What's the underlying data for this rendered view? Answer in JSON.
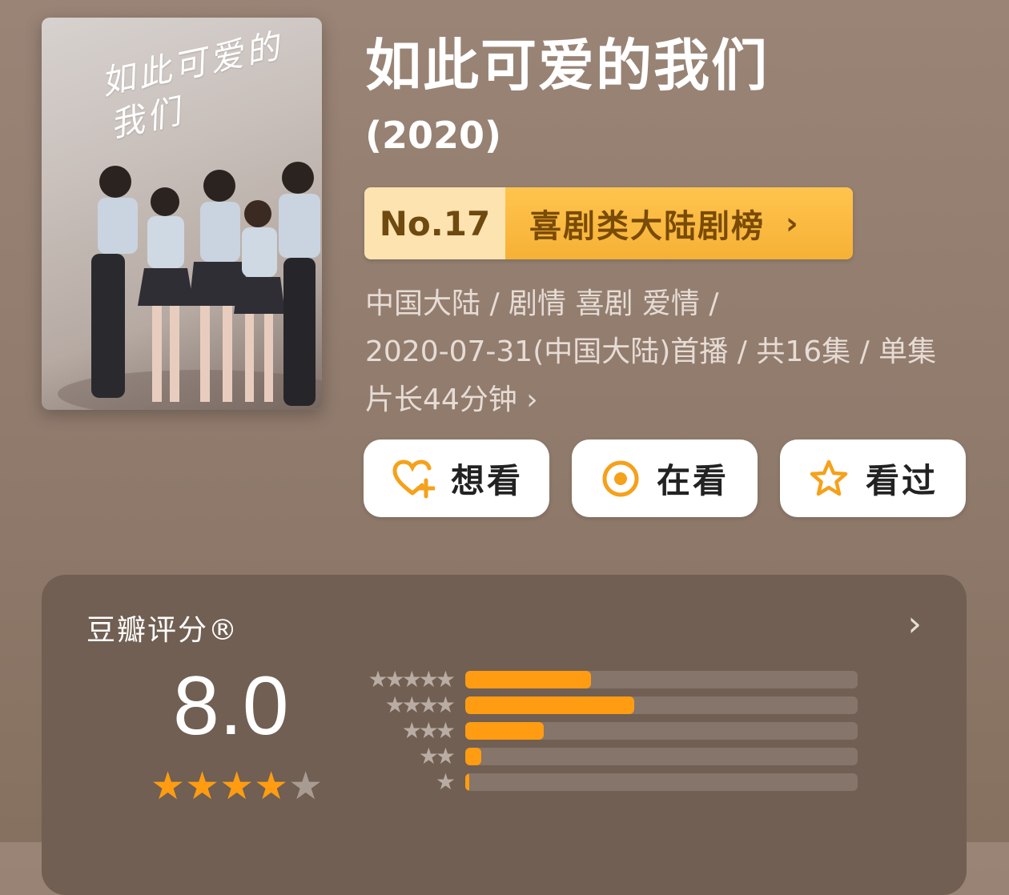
{
  "poster": {
    "title_art": "如此可爱的我们"
  },
  "header": {
    "title": "如此可爱的我们",
    "year": "(2020)"
  },
  "rank": {
    "number": "No.17",
    "list_name": "喜剧类大陆剧榜",
    "chevron": "›"
  },
  "meta": {
    "line1": "中国大陆 / 剧情 喜剧 爱情 /",
    "line2": "2020-07-31(中国大陆)首播 / 共16集 / 单集",
    "line3": "片长44分钟 ›"
  },
  "actions": {
    "want": {
      "label": "想看",
      "icon": "heart-plus-icon"
    },
    "watching": {
      "label": "在看",
      "icon": "target-circle-icon"
    },
    "watched": {
      "label": "看过",
      "icon": "star-outline-icon"
    }
  },
  "rating": {
    "label": "豆瓣评分®",
    "arrow": "›",
    "score": "8.0",
    "star_value": 4,
    "star_max": 5,
    "distribution": [
      {
        "stars": 5,
        "fraction": 0.32
      },
      {
        "stars": 4,
        "fraction": 0.43
      },
      {
        "stars": 3,
        "fraction": 0.2
      },
      {
        "stars": 2,
        "fraction": 0.04
      },
      {
        "stars": 1,
        "fraction": 0.01
      }
    ]
  },
  "colors": {
    "background": "#8f7a6c",
    "accent_orange": "#ff9c12",
    "rank_gold": "#f6b136",
    "card": "#705f52"
  }
}
